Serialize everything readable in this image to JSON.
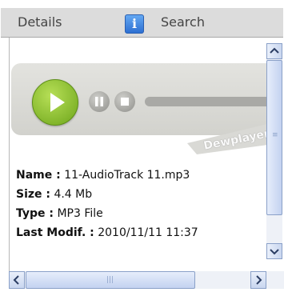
{
  "tabs": {
    "details_label": "Details",
    "search_label": "Search",
    "info_icon_glyph": "i"
  },
  "player": {
    "brand": "Dewplayer"
  },
  "file_info": {
    "name_label": "Name :",
    "name_value": "11-AudioTrack 11.mp3",
    "size_label": "Size :",
    "size_value": "4.4 Mb",
    "type_label": "Type :",
    "type_value": "MP3 File",
    "modified_label": "Last Modif. :",
    "modified_value": "2010/11/11 11:37"
  },
  "colors": {
    "tab_bar": "#dcdcdc",
    "play_green": "#7cb823",
    "scrollbar_blue": "#c3d2f0"
  },
  "icons": [
    "info-icon",
    "play-icon",
    "pause-icon",
    "stop-icon",
    "arrow-up-icon",
    "arrow-down-icon",
    "arrow-left-icon",
    "arrow-right-icon"
  ]
}
